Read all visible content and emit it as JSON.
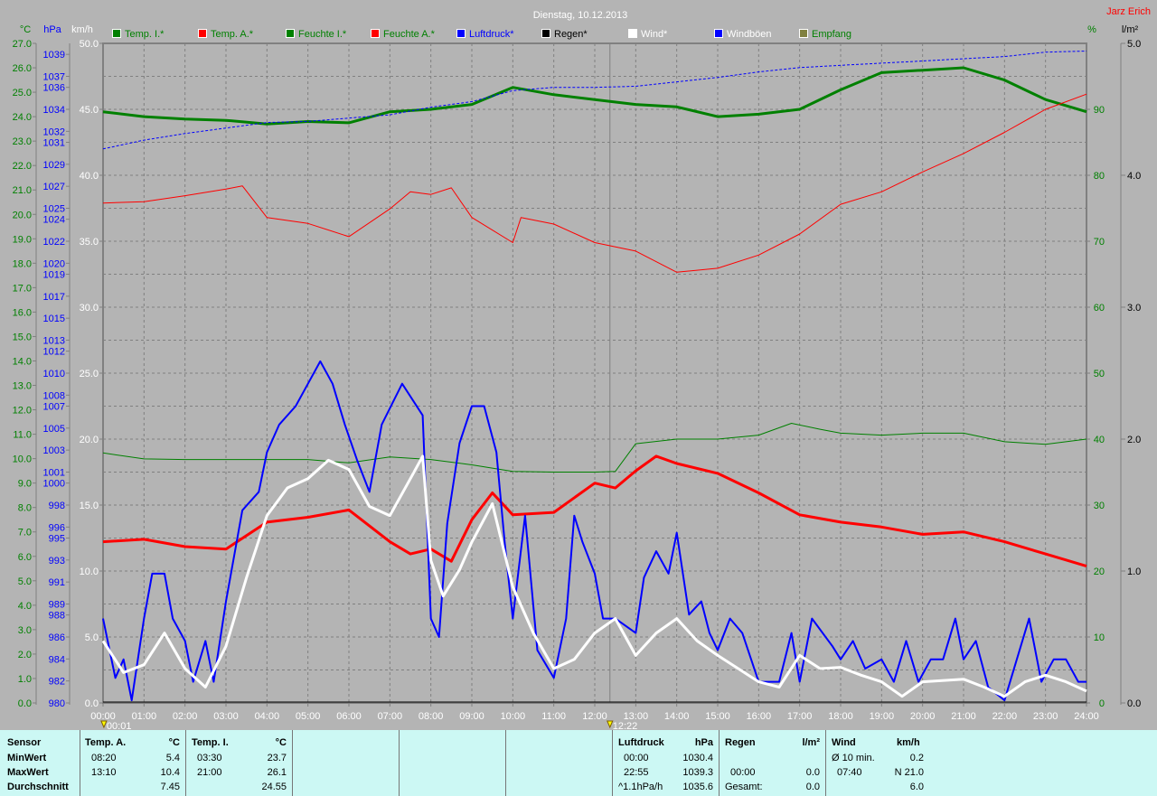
{
  "chart_data": {
    "type": "line",
    "title": "Dienstag, 10.12.2013",
    "author": "Jarz Erich",
    "x_unit": "hours",
    "x_range": [
      0,
      24
    ],
    "x_tick_labels": [
      "00:00",
      "01:00",
      "02:00",
      "03:00",
      "04:00",
      "05:00",
      "06:00",
      "07:00",
      "08:00",
      "09:00",
      "10:00",
      "11:00",
      "12:00",
      "13:00",
      "14:00",
      "15:00",
      "16:00",
      "17:00",
      "18:00",
      "19:00",
      "20:00",
      "21:00",
      "22:00",
      "23:00",
      "24:00"
    ],
    "axes": {
      "celsius": {
        "label": "°C",
        "range": [
          0,
          27
        ],
        "ticks": [
          "0.0",
          "1.0",
          "2.0",
          "3.0",
          "4.0",
          "5.0",
          "6.0",
          "7.0",
          "8.0",
          "9.0",
          "10.0",
          "11.0",
          "12.0",
          "13.0",
          "14.0",
          "15.0",
          "16.0",
          "17.0",
          "18.0",
          "19.0",
          "20.0",
          "21.0",
          "22.0",
          "23.0",
          "24.0",
          "25.0",
          "26.0",
          "27.0"
        ]
      },
      "hpa": {
        "label": "hPa",
        "range": [
          980,
          1040
        ],
        "ticks": [
          "980",
          "982",
          "984",
          "986",
          "988",
          "989",
          "991",
          "993",
          "995",
          "996",
          "998",
          "1000",
          "1001",
          "1003",
          "1005",
          "1007",
          "1008",
          "1010",
          "1012",
          "1013",
          "1015",
          "1017",
          "1019",
          "1020",
          "1022",
          "1024",
          "1025",
          "1027",
          "1029",
          "1031",
          "1032",
          "1034",
          "1036",
          "1037",
          "1039"
        ]
      },
      "kmh": {
        "label": "km/h",
        "range": [
          0,
          50
        ],
        "ticks": [
          "0.0",
          "5.0",
          "10.0",
          "15.0",
          "20.0",
          "25.0",
          "30.0",
          "35.0",
          "40.0",
          "45.0",
          "50.0"
        ]
      },
      "percent": {
        "label": "%",
        "range": [
          0,
          100
        ],
        "ticks": [
          "0",
          "10",
          "20",
          "30",
          "40",
          "50",
          "60",
          "70",
          "80",
          "90"
        ]
      },
      "rain": {
        "label": "l/m²",
        "range": [
          0,
          5
        ],
        "ticks": [
          "0.0",
          "1.0",
          "2.0",
          "3.0",
          "4.0",
          "5.0"
        ]
      }
    },
    "grid": true,
    "legend_position": "top",
    "legend": [
      {
        "name": "Temp. I.*",
        "color": "#008000",
        "text_color": "#008000"
      },
      {
        "name": "Temp. A.*",
        "color": "#ff0000",
        "text_color": "#008000"
      },
      {
        "name": "Feuchte I.*",
        "color": "#008000",
        "text_color": "#008000"
      },
      {
        "name": "Feuchte A.*",
        "color": "#ff0000",
        "text_color": "#008000"
      },
      {
        "name": "Luftdruck*",
        "color": "#0000ff",
        "text_color": "#0000ff"
      },
      {
        "name": "Regen*",
        "color": "#000000",
        "text_color": "#000000"
      },
      {
        "name": "Wind*",
        "color": "#ffffff",
        "text_color": "#ffffff"
      },
      {
        "name": "Windböen",
        "color": "#0000ff",
        "text_color": "#ffffff"
      },
      {
        "name": "Empfang",
        "color": "#808040",
        "text_color": "#008000"
      }
    ],
    "markers": [
      {
        "label": "00:01",
        "x": 0.02
      },
      {
        "label": "12:22",
        "x": 12.37
      }
    ],
    "series": [
      {
        "name": "Temp. I.",
        "axis": "celsius",
        "color": "#008000",
        "width": 3,
        "dash": "",
        "x": [
          0,
          1,
          2,
          3,
          4,
          5,
          6,
          7,
          8,
          9,
          10,
          11,
          12,
          13,
          14,
          15,
          16,
          17,
          18,
          19,
          20,
          21,
          22,
          23,
          24
        ],
        "y": [
          24.2,
          24.0,
          23.9,
          23.85,
          23.7,
          23.8,
          23.75,
          24.2,
          24.3,
          24.5,
          25.2,
          24.9,
          24.7,
          24.5,
          24.4,
          24.0,
          24.1,
          24.3,
          25.1,
          25.8,
          25.9,
          26.0,
          25.5,
          24.7,
          24.2
        ]
      },
      {
        "name": "Temp. A.",
        "axis": "celsius",
        "color": "#ff0000",
        "width": 3,
        "dash": "",
        "x": [
          0,
          1,
          2,
          3,
          4,
          5,
          6,
          7,
          7.5,
          8,
          8.5,
          9,
          9.5,
          10,
          11,
          12,
          12.5,
          13,
          13.5,
          14,
          15,
          16,
          17,
          18,
          19,
          20,
          21,
          22,
          23,
          24
        ],
        "y": [
          6.6,
          6.7,
          6.4,
          6.3,
          7.4,
          7.6,
          7.9,
          6.6,
          6.1,
          6.3,
          5.8,
          7.5,
          8.6,
          7.7,
          7.8,
          9.0,
          8.8,
          9.5,
          10.1,
          9.8,
          9.4,
          8.6,
          7.7,
          7.4,
          7.2,
          6.9,
          7.0,
          6.6,
          6.1,
          5.6
        ]
      },
      {
        "name": "Feuchte I.",
        "axis": "percent",
        "color": "#008000",
        "width": 1,
        "dash": "",
        "x": [
          0,
          1,
          2,
          3,
          4,
          5,
          6,
          7,
          8,
          9,
          10,
          11,
          12,
          12.5,
          13,
          14,
          15,
          16,
          16.8,
          17.5,
          18,
          19,
          20,
          21,
          22,
          23,
          24
        ],
        "y": [
          37.9,
          37.0,
          36.9,
          36.9,
          36.9,
          36.9,
          36.4,
          37.3,
          36.9,
          36.1,
          35.1,
          35.0,
          35.0,
          35.1,
          39.3,
          40.0,
          40.0,
          40.6,
          42.4,
          41.5,
          40.9,
          40.6,
          40.9,
          40.9,
          39.6,
          39.2,
          40.0
        ]
      },
      {
        "name": "Feuchte A.",
        "axis": "percent",
        "color": "#ff0000",
        "width": 1,
        "dash": "",
        "x": [
          0,
          1,
          2,
          3,
          3.4,
          4,
          5,
          6,
          7,
          7.5,
          8,
          8.5,
          9,
          10,
          10.2,
          11,
          12,
          13,
          14,
          15,
          16,
          17,
          18,
          19,
          20,
          21,
          22,
          23,
          24
        ],
        "y": [
          75.8,
          76.0,
          76.9,
          77.9,
          78.4,
          73.6,
          72.7,
          70.7,
          74.9,
          77.5,
          77.1,
          78.1,
          73.6,
          69.8,
          73.6,
          72.6,
          69.8,
          68.5,
          65.3,
          65.9,
          67.9,
          71.1,
          75.6,
          77.5,
          80.5,
          83.3,
          86.5,
          90.0,
          92.3
        ]
      },
      {
        "name": "Luftdruck",
        "axis": "hpa",
        "color": "#0000ff",
        "width": 1,
        "dash": "3,2",
        "x": [
          0,
          1,
          2,
          3,
          4,
          5,
          6,
          7,
          8,
          9,
          10,
          11,
          12,
          13,
          14,
          15,
          16,
          17,
          18,
          19,
          20,
          21,
          22,
          23,
          24
        ],
        "y": [
          1030.4,
          1031.2,
          1031.8,
          1032.3,
          1032.8,
          1032.9,
          1033.2,
          1033.5,
          1034.2,
          1034.7,
          1035.7,
          1036.0,
          1036.0,
          1036.1,
          1036.5,
          1036.9,
          1037.4,
          1037.8,
          1038.0,
          1038.2,
          1038.4,
          1038.6,
          1038.8,
          1039.2,
          1039.3
        ]
      },
      {
        "name": "Windböen",
        "axis": "kmh",
        "color": "#0000ff",
        "width": 2,
        "dash": "",
        "x": [
          0,
          0.3,
          0.5,
          0.7,
          1,
          1.2,
          1.5,
          1.7,
          2,
          2.2,
          2.5,
          2.7,
          3,
          3.4,
          3.8,
          4,
          4.3,
          4.7,
          5,
          5.3,
          5.6,
          5.9,
          6.2,
          6.5,
          6.8,
          7.3,
          7.8,
          8,
          8.2,
          8.4,
          8.7,
          9,
          9.3,
          9.6,
          9.8,
          10,
          10.3,
          10.6,
          11,
          11.3,
          11.5,
          11.7,
          12,
          12.2,
          12.5,
          13,
          13.2,
          13.5,
          13.8,
          14,
          14.3,
          14.6,
          14.8,
          15,
          15.3,
          15.6,
          16,
          16.5,
          16.8,
          17,
          17.3,
          17.8,
          18,
          18.3,
          18.6,
          19,
          19.3,
          19.6,
          19.9,
          20.2,
          20.5,
          20.8,
          21,
          21.3,
          21.6,
          22,
          22.3,
          22.6,
          22.9,
          23.2,
          23.5,
          23.8,
          24
        ],
        "y": [
          6.4,
          1.9,
          3.3,
          0.2,
          6.4,
          9.8,
          9.8,
          6.4,
          4.7,
          1.6,
          4.7,
          1.6,
          7.7,
          14.6,
          16.0,
          19.0,
          21.1,
          22.5,
          24.2,
          25.9,
          24.2,
          21.1,
          18.4,
          16.0,
          21.1,
          24.2,
          21.8,
          6.4,
          5.0,
          13.6,
          19.7,
          22.5,
          22.5,
          19.0,
          12.2,
          6.4,
          14.2,
          4.0,
          1.9,
          6.4,
          14.2,
          12.2,
          9.8,
          6.4,
          6.4,
          5.3,
          9.5,
          11.5,
          9.8,
          12.9,
          6.7,
          7.7,
          5.3,
          4.0,
          6.4,
          5.3,
          1.6,
          1.6,
          5.3,
          1.6,
          6.4,
          4.3,
          3.3,
          4.7,
          2.6,
          3.3,
          1.6,
          4.7,
          1.6,
          3.3,
          3.3,
          6.4,
          3.3,
          4.7,
          1.2,
          0.2,
          3.3,
          6.4,
          1.6,
          3.3,
          3.3,
          1.6,
          1.6
        ]
      },
      {
        "name": "Wind",
        "axis": "kmh",
        "color": "#ffffff",
        "width": 3,
        "dash": "",
        "x": [
          0,
          0.5,
          1,
          1.5,
          2,
          2.5,
          3,
          3.5,
          4,
          4.5,
          5,
          5.5,
          6,
          6.5,
          7,
          7.5,
          7.8,
          8,
          8.3,
          8.7,
          9,
          9.5,
          10,
          10.5,
          11,
          11.5,
          12,
          12.5,
          13,
          13.5,
          14,
          14.5,
          15,
          15.5,
          16,
          16.5,
          17,
          17.5,
          18,
          18.5,
          19,
          19.5,
          20,
          21,
          21.5,
          22,
          22.5,
          23,
          23.5,
          24
        ],
        "y": [
          4.7,
          2.3,
          2.9,
          5.3,
          2.6,
          1.2,
          4.3,
          9.5,
          14.2,
          16.3,
          17.0,
          18.4,
          17.7,
          14.9,
          14.2,
          17.0,
          18.7,
          10.8,
          8.1,
          10.1,
          12.2,
          15.1,
          8.8,
          5.3,
          2.6,
          3.3,
          5.3,
          6.4,
          3.6,
          5.3,
          6.4,
          4.7,
          3.6,
          2.6,
          1.6,
          1.2,
          3.6,
          2.6,
          2.7,
          2.1,
          1.6,
          0.5,
          1.6,
          1.8,
          1.2,
          0.5,
          1.6,
          2.1,
          1.6,
          0.9
        ]
      }
    ]
  },
  "summary": {
    "sensor": {
      "header": "Sensor",
      "rows": [
        "MinWert",
        "MaxWert",
        "Durchschnitt"
      ]
    },
    "temp_a": {
      "header": "Temp. A.",
      "unit": "°C",
      "min_time": "08:20",
      "min": "5.4",
      "max_time": "13:10",
      "max": "10.4",
      "avg": "7.45"
    },
    "temp_i": {
      "header": "Temp. I.",
      "unit": "°C",
      "min_time": "03:30",
      "min": "23.7",
      "max_time": "21:00",
      "max": "26.1",
      "avg": "24.55"
    },
    "pressure": {
      "header": "Luftdruck",
      "unit": "hPa",
      "r1_label": "00:00",
      "r1": "1030.4",
      "r2_label": "22:55",
      "r2": "1039.3",
      "r3_label": "^1.1hPa/h",
      "r3": "1035.6"
    },
    "rain": {
      "header": "Regen",
      "unit": "l/m²",
      "r2_label": "00:00",
      "r2": "0.0",
      "r3_label": "Gesamt:",
      "r3": "0.0"
    },
    "wind": {
      "header": "Wind",
      "unit": "km/h",
      "r1_label": "Ø 10 min.",
      "r1": "0.2",
      "r2_label": "07:40",
      "r2": "N 21.0",
      "r3": "6.0"
    }
  }
}
